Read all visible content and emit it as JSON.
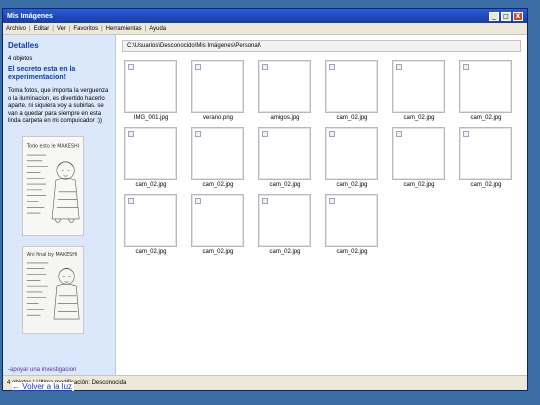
{
  "window": {
    "title": "Mis Imágenes"
  },
  "titlebar_buttons": [
    "_",
    "□",
    "X"
  ],
  "menu": [
    "Archivo",
    "Editar",
    "Ver",
    "Favoritos",
    "Herramientas",
    "Ayuda"
  ],
  "sidebar": {
    "title": "Detalles",
    "count": "4 objetos",
    "headline": "El secreto esta en la experimentacion!",
    "text": "Toma fotos, que importa la verguenza o la iluminacion, es divertido hacerlo aparte, ni siquiera voy a subirlas. se van a quedar para siempre en esta linda carpeta en mi compuicador :))",
    "sketch1_caption": "Todo esto le MAKESHI",
    "sketch2_caption": "Ahí final by MAKESHI",
    "link": "-apoyar una investigacion"
  },
  "address": "C:\\Usuarios\\Desconocido\\Mis Imágenes\\Personal\\",
  "files": [
    {
      "name": "IMG_001.jpg"
    },
    {
      "name": "verano.png"
    },
    {
      "name": "amigos.jpg"
    },
    {
      "name": "cam_02.jpg"
    },
    {
      "name": "cam_02.jpg"
    },
    {
      "name": "cam_02.jpg"
    },
    {
      "name": "cam_02.jpg"
    },
    {
      "name": "cam_02.jpg"
    },
    {
      "name": "cam_02.jpg"
    },
    {
      "name": "cam_02.jpg"
    },
    {
      "name": "cam_02.jpg"
    },
    {
      "name": "cam_02.jpg"
    },
    {
      "name": "cam_02.jpg"
    },
    {
      "name": "cam_02.jpg"
    },
    {
      "name": "cam_02.jpg"
    },
    {
      "name": "cam_02.jpg"
    }
  ],
  "status": "4 objetos | Ultima modificación: Desconocida",
  "back_link": "← Volver a la luz",
  "colors": {
    "desktop": "#3a6ea5",
    "titlebar": "#1c47b8",
    "sidebar_bg": "#dbe7fb",
    "sidebar_heading": "#0c3dad",
    "link": "#1a36c9"
  }
}
